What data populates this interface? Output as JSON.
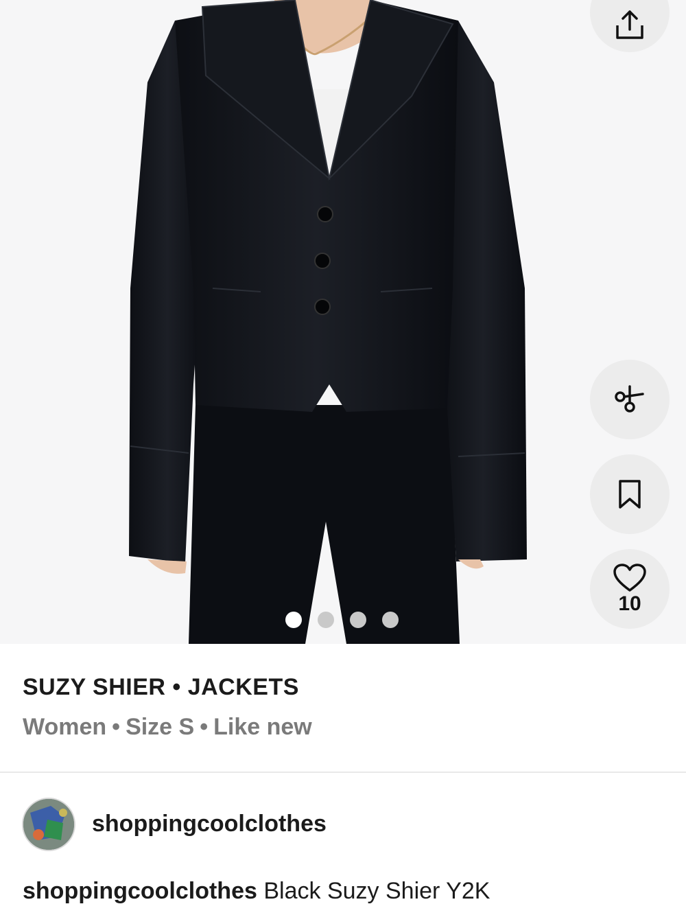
{
  "product": {
    "brand_category": "SUZY SHIER • JACKETS",
    "meta": [
      "Women",
      "Size S",
      "Like new"
    ],
    "meta_separator": "•"
  },
  "actions": {
    "share_icon": "share-icon",
    "compare_icon": "scissors-icon",
    "save_icon": "bookmark-icon",
    "like_icon": "heart-icon",
    "like_count": "10"
  },
  "carousel": {
    "total": 4,
    "active": 1
  },
  "seller": {
    "username": "shoppingcoolclothes"
  },
  "description": {
    "user": "shoppingcoolclothes",
    "text": "Black Suzy Shier Y2K"
  },
  "colors": {
    "background": "#ffffff",
    "button_bg": "#ececec",
    "muted_text": "#7a7a7a"
  }
}
